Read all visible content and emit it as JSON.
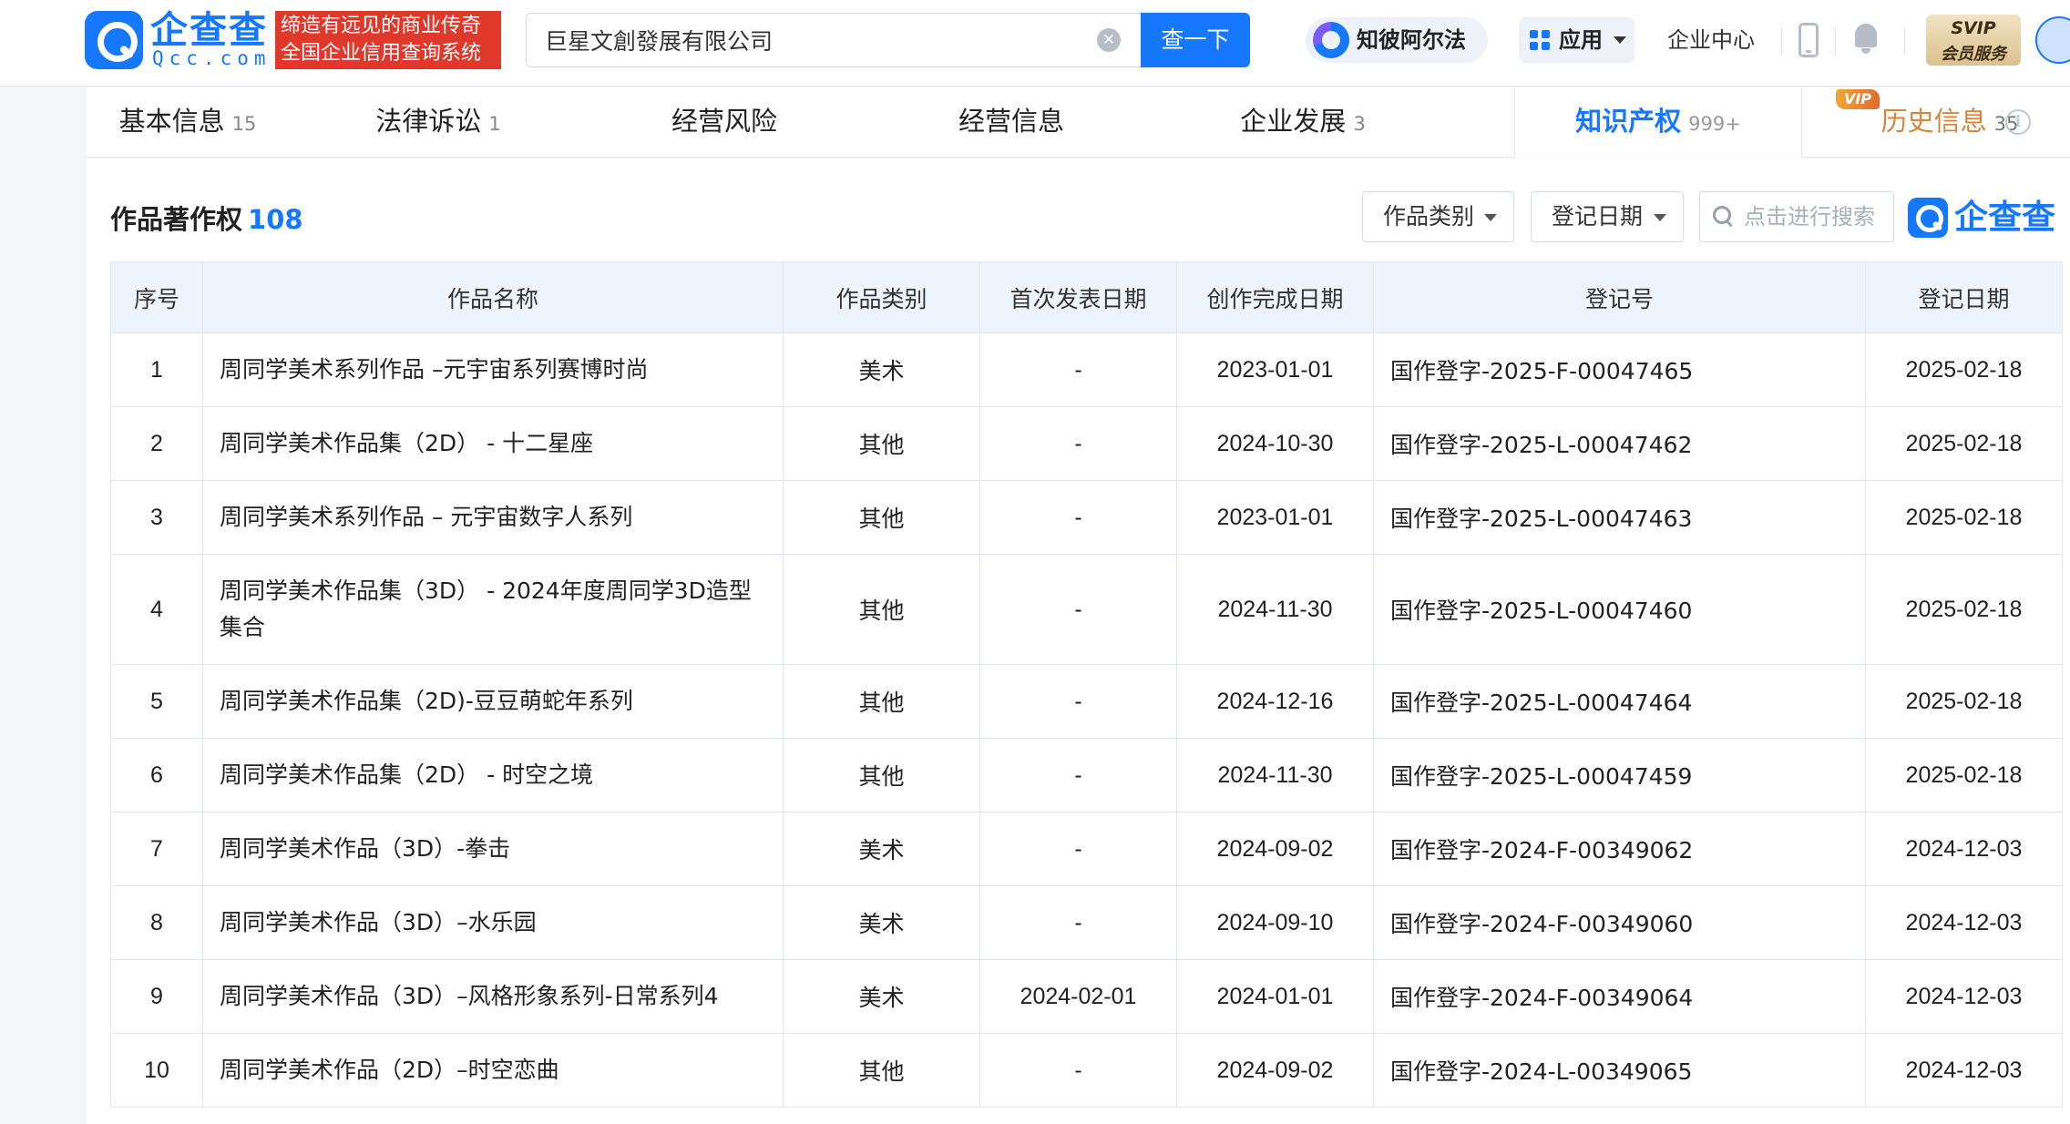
{
  "header": {
    "logo_text": "企查查",
    "logo_sub": "Qcc.com",
    "slogan_line1": "缔造有远见的商业传奇",
    "slogan_line2": "全国企业信用查询系统",
    "search_value": "巨星文創發展有限公司",
    "search_button": "查一下",
    "zhibi_label": "知彼阿尔法",
    "apps_label": "应用",
    "enterprise_center": "企业中心",
    "svip_top": "SVIP",
    "svip_bottom": "会员服务"
  },
  "nav": {
    "tabs": [
      {
        "label": "基本信息",
        "count": "15"
      },
      {
        "label": "法律诉讼",
        "count": "1"
      },
      {
        "label": "经营风险",
        "count": ""
      },
      {
        "label": "经营信息",
        "count": ""
      },
      {
        "label": "企业发展",
        "count": "3"
      },
      {
        "label": "知识产权",
        "count": "999+"
      },
      {
        "label": "历史信息",
        "count": "35"
      }
    ],
    "active_tab": "知识产权",
    "vip_badge": "VIP"
  },
  "section": {
    "title": "作品著作权",
    "count": "108",
    "filter_category": "作品类别",
    "filter_date": "登记日期",
    "search_placeholder": "点击进行搜索",
    "watermark": "企查查"
  },
  "table": {
    "headers": [
      "序号",
      "作品名称",
      "作品类别",
      "首次发表日期",
      "创作完成日期",
      "登记号",
      "登记日期"
    ],
    "rows": [
      {
        "no": "1",
        "name": "周同学美术系列作品 –元宇宙系列赛博时尚",
        "category": "美术",
        "first_pub": "-",
        "completed": "2023-01-01",
        "reg_no": "国作登字-2025-F-00047465",
        "reg_date": "2025-02-18"
      },
      {
        "no": "2",
        "name": "周同学美术作品集（2D） - 十二星座",
        "category": "其他",
        "first_pub": "-",
        "completed": "2024-10-30",
        "reg_no": "国作登字-2025-L-00047462",
        "reg_date": "2025-02-18"
      },
      {
        "no": "3",
        "name": "周同学美术系列作品 – 元宇宙数字人系列",
        "category": "其他",
        "first_pub": "-",
        "completed": "2023-01-01",
        "reg_no": "国作登字-2025-L-00047463",
        "reg_date": "2025-02-18"
      },
      {
        "no": "4",
        "name": "周同学美术作品集（3D） - 2024年度周同学3D造型集合",
        "category": "其他",
        "first_pub": "-",
        "completed": "2024-11-30",
        "reg_no": "国作登字-2025-L-00047460",
        "reg_date": "2025-02-18"
      },
      {
        "no": "5",
        "name": "周同学美术作品集（2D)-豆豆萌蛇年系列",
        "category": "其他",
        "first_pub": "-",
        "completed": "2024-12-16",
        "reg_no": "国作登字-2025-L-00047464",
        "reg_date": "2025-02-18"
      },
      {
        "no": "6",
        "name": "周同学美术作品集（2D） - 时空之境",
        "category": "其他",
        "first_pub": "-",
        "completed": "2024-11-30",
        "reg_no": "国作登字-2025-L-00047459",
        "reg_date": "2025-02-18"
      },
      {
        "no": "7",
        "name": "周同学美术作品（3D）-拳击",
        "category": "美术",
        "first_pub": "-",
        "completed": "2024-09-02",
        "reg_no": "国作登字-2024-F-00349062",
        "reg_date": "2024-12-03"
      },
      {
        "no": "8",
        "name": "周同学美术作品（3D）–水乐园",
        "category": "美术",
        "first_pub": "-",
        "completed": "2024-09-10",
        "reg_no": "国作登字-2024-F-00349060",
        "reg_date": "2024-12-03"
      },
      {
        "no": "9",
        "name": "周同学美术作品（3D）–风格形象系列-日常系列4",
        "category": "美术",
        "first_pub": "2024-02-01",
        "completed": "2024-01-01",
        "reg_no": "国作登字-2024-F-00349064",
        "reg_date": "2024-12-03"
      },
      {
        "no": "10",
        "name": "周同学美术作品（2D）–时空恋曲",
        "category": "其他",
        "first_pub": "-",
        "completed": "2024-09-02",
        "reg_no": "国作登字-2024-L-00349065",
        "reg_date": "2024-12-03"
      }
    ]
  },
  "colors": {
    "brand": "#1677ff",
    "slogan_bg": "#e0392b",
    "history_tab": "#d8843a",
    "table_header_bg": "#eef4fd"
  }
}
